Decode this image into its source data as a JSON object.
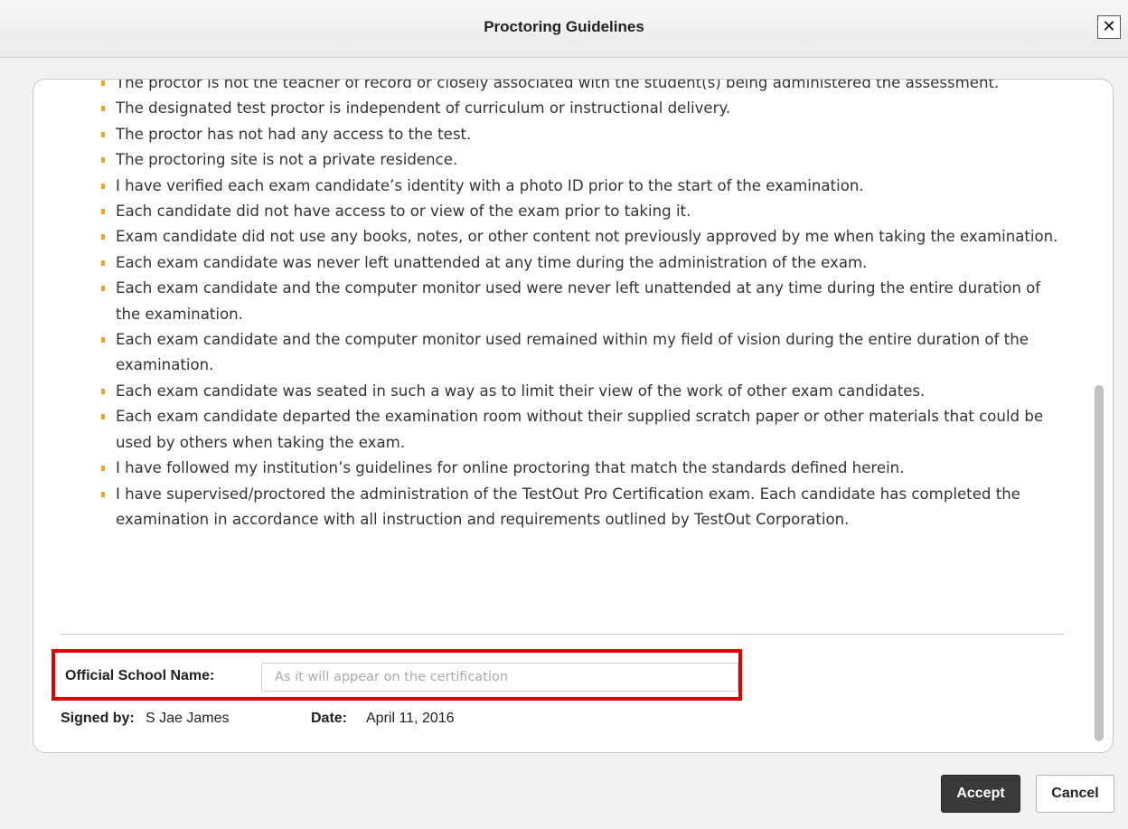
{
  "dialog": {
    "title": "Proctoring Guidelines",
    "close_label": "✕"
  },
  "guidelines": [
    "The proctor is not the teacher of record or closely associated with the student(s) being administered the assessment.",
    "The designated test proctor is independent of curriculum or instructional delivery.",
    "The proctor has not had any access to the test.",
    "The proctoring site is not a private residence.",
    "I have verified each exam candidate’s identity with a photo ID prior to the start of the examination.",
    "Each candidate did not have access to or view of the exam prior to taking it.",
    "Exam candidate did not use any books, notes, or other content not previously approved by me when taking the examination.",
    "Each exam candidate was never left unattended at any time during the administration of the exam.",
    "Each exam candidate and the computer monitor used were never left unattended at any time during the entire duration of the examination.",
    "Each exam candidate and the computer monitor used remained within my field of vision during the entire duration of the examination.",
    "Each exam candidate was seated in such a way as to limit their view of the work of other exam candidates.",
    "Each exam candidate departed the examination room without their supplied scratch paper or other materials that could be used by others when taking the exam.",
    "I have followed my institution’s guidelines for online proctoring that match the standards defined herein.",
    "I have supervised/proctored the administration of the TestOut Pro Certification exam. Each candidate has completed the examination in accordance with all instruction and requirements outlined by TestOut Corporation."
  ],
  "form": {
    "school_label": "Official School Name:",
    "school_value": "",
    "school_placeholder": "As it will appear on the certification",
    "signed_label": "Signed by:",
    "signed_value": "S Jae James",
    "date_label": "Date:",
    "date_value": "April 11, 2016"
  },
  "buttons": {
    "accept": "Accept",
    "cancel": "Cancel"
  },
  "colors": {
    "bullet": "#f2a31d",
    "highlight_border": "#e00000",
    "accept_bg": "#3a3a3a"
  }
}
